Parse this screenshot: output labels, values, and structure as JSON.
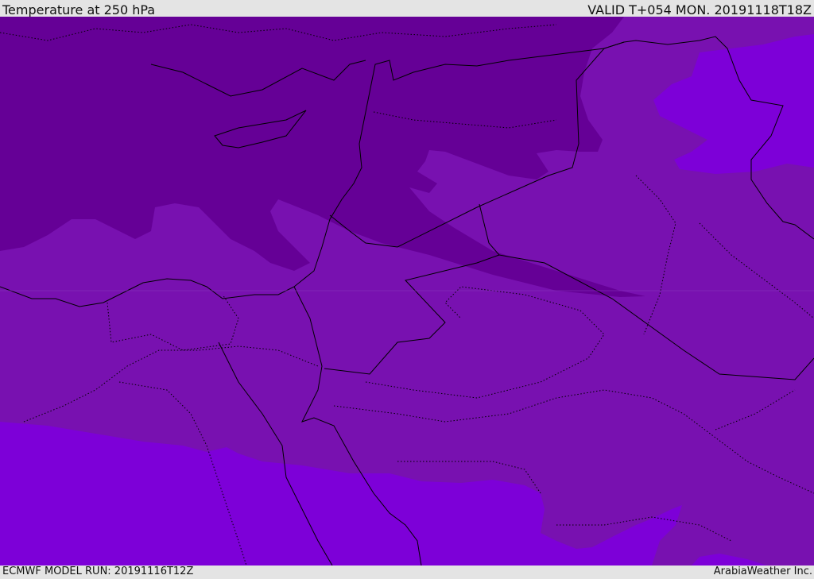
{
  "header": {
    "title": "Temperature at 250 hPa",
    "valid": "VALID T+054 MON. 20191118T18Z"
  },
  "footer": {
    "model_run": "ECMWF MODEL RUN: 20191116T12Z",
    "credit": "ArabiaWeather Inc."
  },
  "colors": {
    "cold": "#650096",
    "mid": "#7811b0",
    "warm": "#7d00d8",
    "background": "#e4e4e4"
  }
}
